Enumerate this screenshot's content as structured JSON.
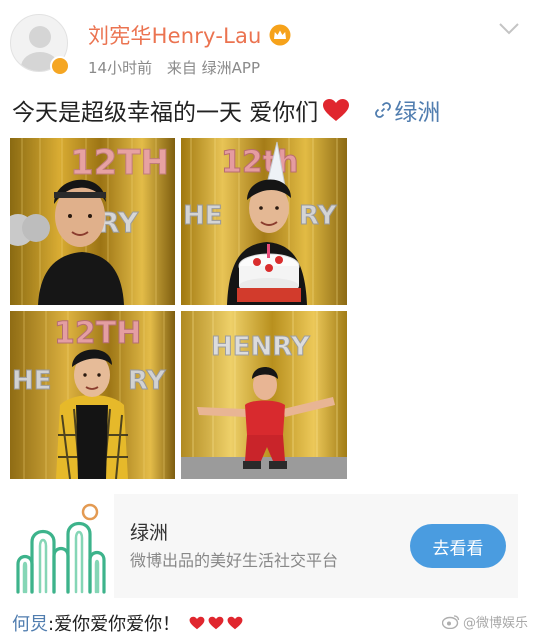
{
  "header": {
    "username": "刘宪华Henry-Lau",
    "time": "14小时前",
    "source": "来自 绿洲APP"
  },
  "post": {
    "text": "今天是超级幸福的一天 爱你们",
    "link_label": "绿洲",
    "photos": [
      {
        "balloon_text": "12TH"
      },
      {
        "balloon_text": "12th"
      },
      {
        "balloon_text": "12TH"
      },
      {
        "balloon_text": "HENRY"
      }
    ]
  },
  "card": {
    "title": "绿洲",
    "subtitle": "微博出品的美好生活社交平台",
    "button": "去看看"
  },
  "comment": {
    "author": "何炅",
    "text": ":爱你爱你爱你！"
  },
  "watermark": {
    "text": "@微博娱乐"
  },
  "colors": {
    "username": "#eb7350",
    "link": "#507daf",
    "button": "#4a9ce0",
    "heart": "#e0262e",
    "badge": "#f5a623"
  }
}
